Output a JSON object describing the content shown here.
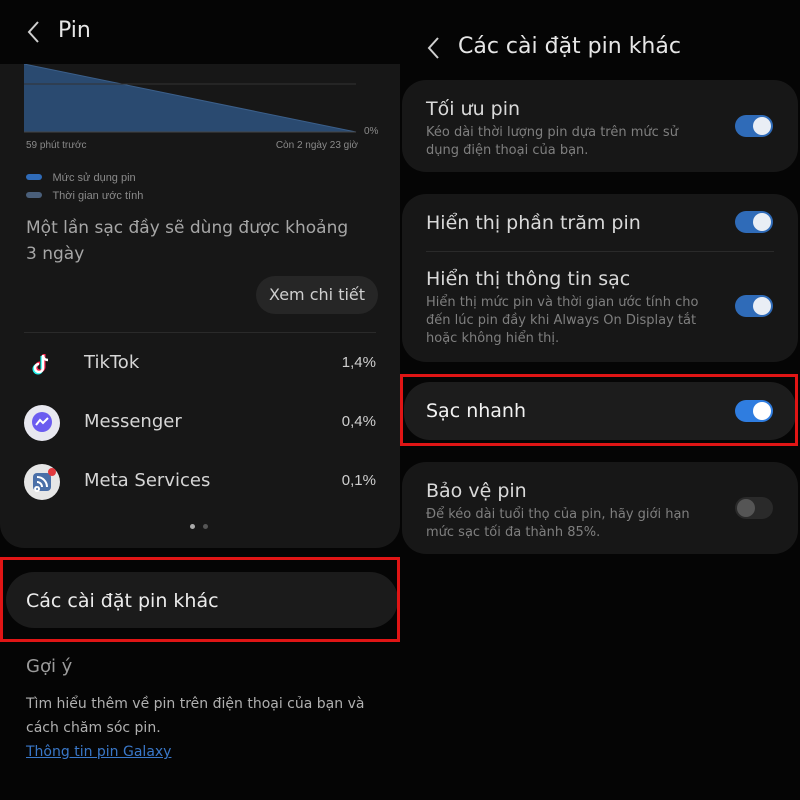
{
  "left": {
    "header": {
      "title": "Pin"
    },
    "chart": {
      "left_label": "59 phút trước",
      "right_label": "Còn 2 ngày 23 giờ",
      "pct_label": "0%",
      "legend": [
        "Mức sử dụng pin",
        "Thời gian ước tính"
      ]
    },
    "estimate_line1": "Một lần sạc đầy sẽ dùng được khoảng",
    "estimate_line2": "3 ngày",
    "details_button": "Xem chi tiết",
    "apps": [
      {
        "name": "TikTok",
        "pct": "1,4%",
        "icon": "tiktok-icon"
      },
      {
        "name": "Messenger",
        "pct": "0,4%",
        "icon": "messenger-icon"
      },
      {
        "name": "Meta Services",
        "pct": "0,1%",
        "icon": "meta-services-icon"
      }
    ],
    "more_settings": "Các cài đặt pin khác",
    "suggest": {
      "heading": "Gợi ý",
      "text1": "Tìm hiểu thêm về pin trên điện thoại của bạn và",
      "text2": "cách chăm sóc pin.",
      "link": "Thông tin pin Galaxy"
    }
  },
  "right": {
    "header": {
      "title": "Các cài đặt pin khác"
    },
    "optimize": {
      "title": "Tối ưu pin",
      "desc1": "Kéo dài thời lượng pin dựa trên mức sử",
      "desc2": "dụng điện thoại của bạn.",
      "on": true
    },
    "show_percent": {
      "title": "Hiển thị phần trăm pin",
      "on": true
    },
    "charging_info": {
      "title": "Hiển thị thông tin sạc",
      "desc1": "Hiển thị mức pin và thời gian ước tính cho",
      "desc2": "đến lúc pin đầy khi Always On Display tắt",
      "desc3": "hoặc không hiển thị.",
      "on": true
    },
    "fast_charge": {
      "title": "Sạc nhanh",
      "on": true
    },
    "protect": {
      "title": "Bảo vệ pin",
      "desc1": "Để kéo dài tuổi thọ của pin, hãy giới hạn",
      "desc2": "mức sạc tối đa thành 85%.",
      "on": false
    }
  },
  "colors": {
    "accent": "#2f6bb8",
    "highlight": "#e01515",
    "link": "#3a78c9"
  }
}
